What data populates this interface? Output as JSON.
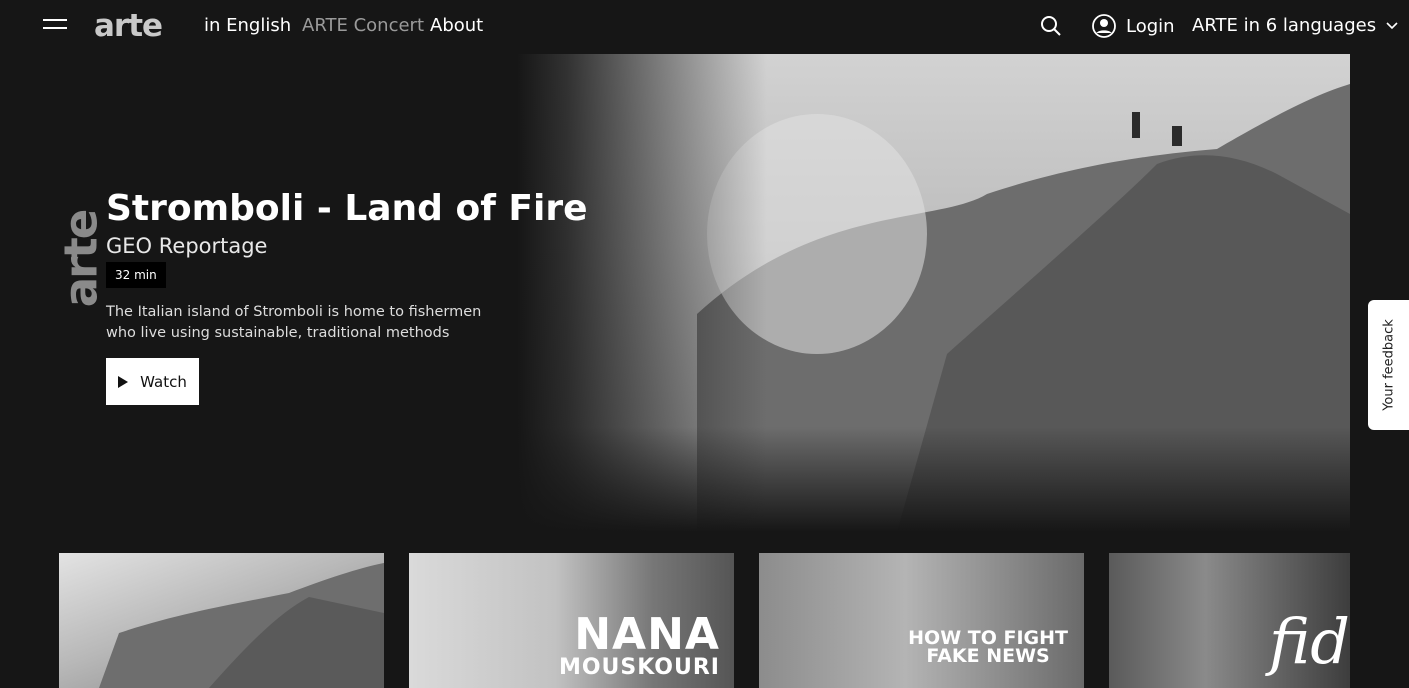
{
  "header": {
    "logo": "arte",
    "nav": [
      "in English",
      "ARTE Concert",
      "About"
    ],
    "login_label": "Login",
    "language_label": "ARTE in 6 languages"
  },
  "hero": {
    "logo_vertical": "arte",
    "title": "Stromboli - Land of Fire",
    "subtitle": "GEO Reportage",
    "duration": "32 min",
    "description": "The Italian island of Stromboli is home to fishermen who live using sustainable, traditional methods",
    "watch_label": "Watch"
  },
  "feedback_label": "Your feedback",
  "cards": [
    {
      "overlay": ""
    },
    {
      "overlay_line1": "NANA",
      "overlay_line2": "MOUSKOURI"
    },
    {
      "overlay_line1": "HOW TO FIGHT",
      "overlay_line2": "FAKE NEWS"
    },
    {
      "overlay": "fid"
    }
  ],
  "icons": {
    "menu": "hamburger-icon",
    "search": "search-icon",
    "user": "user-icon",
    "chevron": "chevron-down-icon",
    "play": "play-icon"
  }
}
